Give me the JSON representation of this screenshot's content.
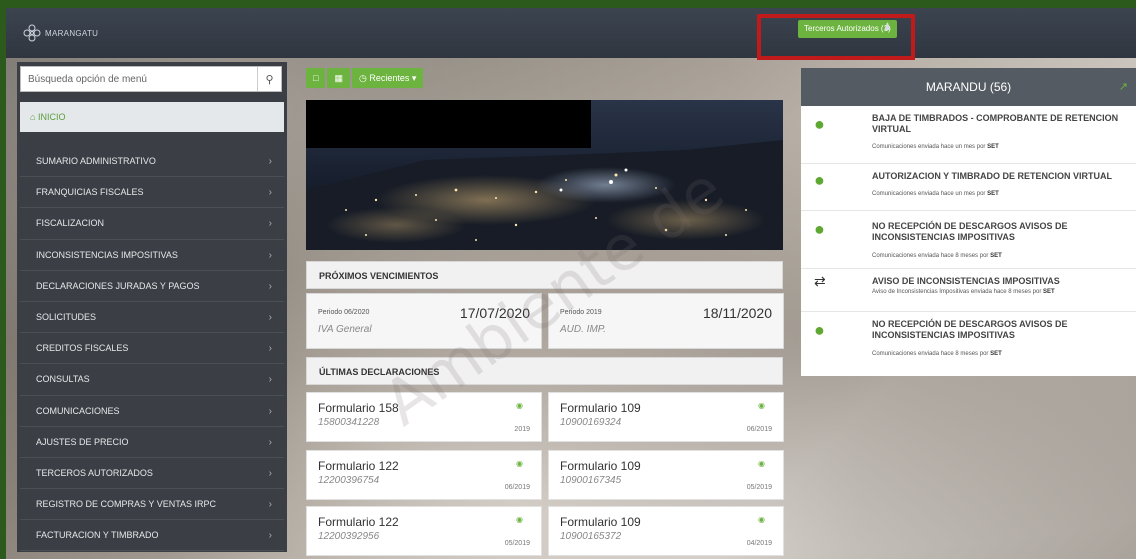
{
  "header": {
    "logo_text": "MARANGATU",
    "authorized_button": "Terceros Autorizados (1)"
  },
  "sidebar": {
    "search_placeholder": "Búsqueda opción de menú",
    "home_label": "INICIO",
    "items": [
      {
        "label": "SUMARIO ADMINISTRATIVO"
      },
      {
        "label": "FRANQUICIAS FISCALES"
      },
      {
        "label": "FISCALIZACION"
      },
      {
        "label": "INCONSISTENCIAS IMPOSITIVAS"
      },
      {
        "label": "DECLARACIONES JURADAS Y PAGOS"
      },
      {
        "label": "SOLICITUDES"
      },
      {
        "label": "CREDITOS FISCALES"
      },
      {
        "label": "CONSULTAS"
      },
      {
        "label": "COMUNICACIONES"
      },
      {
        "label": "AJUSTES DE PRECIO"
      },
      {
        "label": "TERCEROS AUTORIZADOS"
      },
      {
        "label": "REGISTRO DE COMPRAS Y VENTAS IRPC"
      },
      {
        "label": "FACTURACION Y TIMBRADO"
      }
    ]
  },
  "toolbar": {
    "recent_label": "Recientes"
  },
  "vencimientos": {
    "title": "PRÓXIMOS VENCIMIENTOS",
    "cards": [
      {
        "period": "Periodo 06/2020",
        "date": "17/07/2020",
        "tax": "IVA General"
      },
      {
        "period": "Periodo 2019",
        "date": "18/11/2020",
        "tax": "AUD. IMP."
      }
    ]
  },
  "declaraciones": {
    "title": "ÚLTIMAS DECLARACIONES",
    "cards": [
      {
        "form": "Formulario 158",
        "number": "15800341228",
        "period": "2019"
      },
      {
        "form": "Formulario 109",
        "number": "10900169324",
        "period": "06/2019"
      },
      {
        "form": "Formulario 122",
        "number": "12200396754",
        "period": "06/2019"
      },
      {
        "form": "Formulario 109",
        "number": "10900167345",
        "period": "05/2019"
      },
      {
        "form": "Formulario 122",
        "number": "12200392956",
        "period": "05/2019"
      },
      {
        "form": "Formulario 109",
        "number": "10900165372",
        "period": "04/2019"
      }
    ]
  },
  "marandu": {
    "title": "MARANDU (56)",
    "messages": [
      {
        "title": "BAJA DE TIMBRADOS - COMPROBANTE DE RETENCION VIRTUAL",
        "meta": "Comunicaciones enviada hace un mes por",
        "sender": "SET",
        "icon": "comment-icon"
      },
      {
        "title": "AUTORIZACION Y TIMBRADO DE RETENCION VIRTUAL",
        "meta": "Comunicaciones enviada hace un mes por",
        "sender": "SET",
        "icon": "comment-icon"
      },
      {
        "title": "NO RECEPCIÓN DE DESCARGOS AVISOS DE INCONSISTENCIAS IMPOSITIVAS",
        "meta": "Comunicaciones enviada hace 8 meses por",
        "sender": "SET",
        "icon": "comment-icon"
      },
      {
        "title": "AVISO DE INCONSISTENCIAS IMPOSITIVAS",
        "meta": "Aviso de Inconsistencias Impositivas enviada hace 8 meses por",
        "sender": "SET",
        "icon": "shuffle-icon"
      },
      {
        "title": "NO RECEPCIÓN DE DESCARGOS AVISOS DE INCONSISTENCIAS IMPOSITIVAS",
        "meta": "Comunicaciones enviada hace 8 meses por",
        "sender": "SET",
        "icon": "comment-icon"
      }
    ]
  },
  "watermark": "Ambiente de",
  "colors": {
    "accent": "#6db33f",
    "header": "#2f3640",
    "sidebar": "#3b3f45",
    "highlight": "#c11a1a"
  }
}
